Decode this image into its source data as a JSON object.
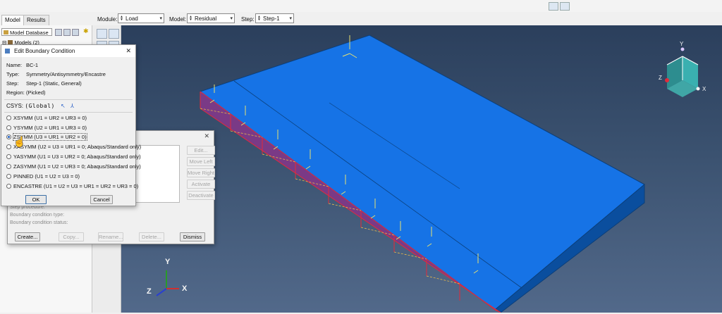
{
  "tabs": [
    {
      "label": "Model",
      "active": true
    },
    {
      "label": "Results",
      "active": false
    }
  ],
  "context": {
    "module_label": "Module:",
    "module_value": "Load",
    "model_label": "Model:",
    "model_value": "Residual Stress",
    "step_label": "Step:",
    "step_value": "Step-1"
  },
  "tree": {
    "dropdown_value": "Model Database",
    "root_label": "Models (2)"
  },
  "manager": {
    "list_buttons": [
      "Edit...",
      "Move Left",
      "Move Right",
      "Activate",
      "Deactivate"
    ],
    "fields": [
      "Step procedure:",
      "Boundary condition type:",
      "Boundary condition status:"
    ],
    "buttons": [
      "Create...",
      "Copy...",
      "Rename...",
      "Delete...",
      "Dismiss"
    ]
  },
  "edit_bc": {
    "title": "Edit Boundary Condition",
    "name_label": "Name:",
    "name_value": "BC-1",
    "type_label": "Type:",
    "type_value": "Symmetry/Antisymmetry/Encastre",
    "step_label": "Step:",
    "step_value": "Step-1 (Static, General)",
    "region_label": "Region:",
    "region_value": "(Picked)",
    "csys_label": "CSYS:",
    "csys_value": "(Global)",
    "options": [
      {
        "label": "XSYMM (U1 = UR2 = UR3 = 0)",
        "selected": false
      },
      {
        "label": "YSYMM (U2 = UR1 = UR3 = 0)",
        "selected": false
      },
      {
        "label": "ZSYMM (U3 = UR1 = UR2 = 0)",
        "selected": true
      },
      {
        "label": "XASYMM (U2 = U3 = UR1 = 0; Abaqus/Standard only)",
        "selected": false
      },
      {
        "label": "YASYMM (U1 = U3 = UR2 = 0; Abaqus/Standard only)",
        "selected": false
      },
      {
        "label": "ZASYMM (U1 = U2 = UR3 = 0; Abaqus/Standard only)",
        "selected": false
      },
      {
        "label": "PINNED (U1 = U2 = U3 = 0)",
        "selected": false
      },
      {
        "label": "ENCASTRE (U1 = U2 = U3 = UR1 = UR2 = UR3 = 0)",
        "selected": false
      }
    ],
    "ok_label": "OK",
    "cancel_label": "Cancel"
  },
  "viewport": {
    "axis_labels": {
      "x": "X",
      "y": "Y",
      "z": "Z"
    },
    "colors": {
      "part_top": "#1673e6",
      "part_side": "#0e5cc0",
      "part_end": "#0a4e9e",
      "bc_face": "#8c3f8a",
      "bc_edge": "#e32a3a",
      "triad_yellow": "#e8e070",
      "background_top": "#2b3f5c",
      "background_bottom": "#52698a"
    }
  }
}
